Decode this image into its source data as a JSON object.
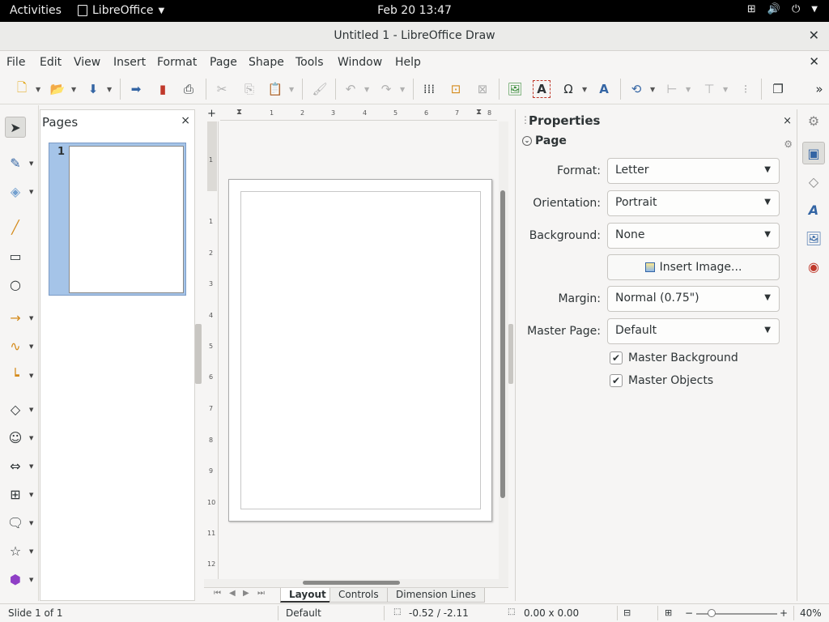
{
  "topbar": {
    "activities": "Activities",
    "app_name": "LibreOffice",
    "clock": "Feb 20  13:47"
  },
  "window": {
    "title": "Untitled 1 - LibreOffice Draw"
  },
  "menu": [
    "File",
    "Edit",
    "View",
    "Insert",
    "Format",
    "Page",
    "Shape",
    "Tools",
    "Window",
    "Help"
  ],
  "pages_panel": {
    "title": "Pages",
    "pages": [
      {
        "number": "1"
      }
    ]
  },
  "ruler": {
    "h_ticks": [
      "1",
      "2",
      "3",
      "4",
      "5",
      "6",
      "7",
      "8"
    ],
    "v_ticks": [
      "1",
      "1",
      "2",
      "3",
      "4",
      "5",
      "6",
      "7",
      "8",
      "9",
      "10",
      "11",
      "12"
    ]
  },
  "tabs": [
    "Layout",
    "Controls",
    "Dimension Lines"
  ],
  "properties": {
    "title": "Properties",
    "section": "Page",
    "format": {
      "label": "Format:",
      "value": "Letter"
    },
    "orientation": {
      "label": "Orientation:",
      "value": "Portrait"
    },
    "background": {
      "label": "Background:",
      "value": "None"
    },
    "insert_image": "Insert Image...",
    "margin": {
      "label": "Margin:",
      "value": "Normal (0.75\")"
    },
    "master_page": {
      "label": "Master Page:",
      "value": "Default"
    },
    "master_background": {
      "label": "Master Background",
      "checked": true
    },
    "master_objects": {
      "label": "Master Objects",
      "checked": true
    }
  },
  "status": {
    "slide": "Slide 1 of 1",
    "layout": "Default",
    "position": "-0.52 / -2.11",
    "size": "0.00 x 0.00",
    "zoom": "40%"
  },
  "colors": {
    "accent_selection": "#a5c4e8",
    "line_color": "#3465a4",
    "fill_color": "#729fcf"
  }
}
